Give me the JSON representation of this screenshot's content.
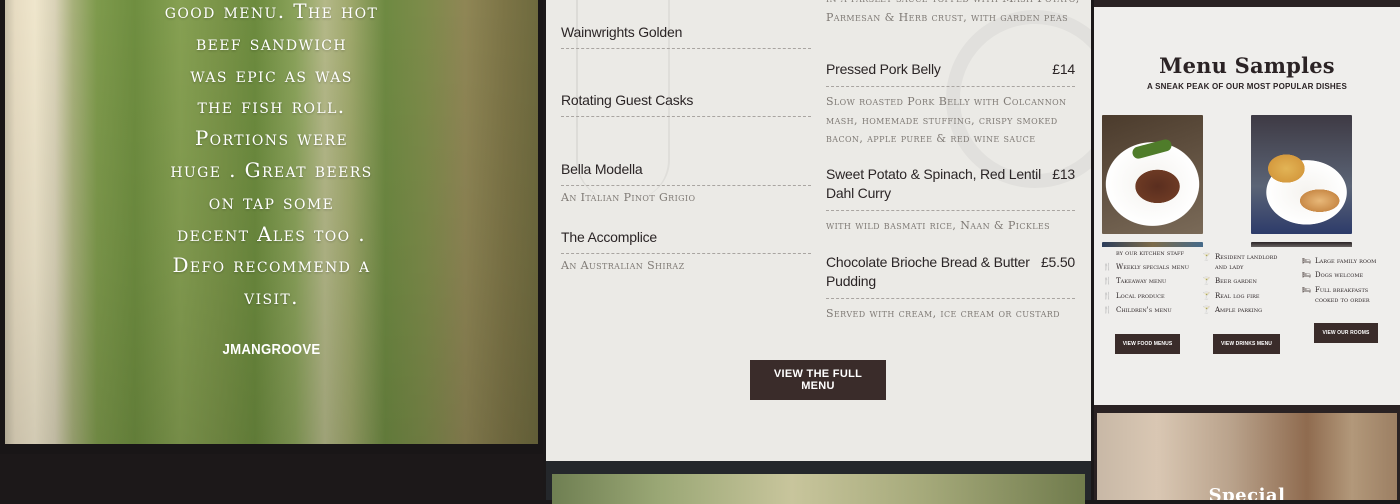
{
  "review": {
    "text": "good menu. The hot\nbeef sandwich\nwas epic as was\nthe fish roll.\nPortions were\nhuge . Great beers\non tap some\ndecent Ales too .\nDefo recommend a\nvisit.",
    "author": "JMANGROOVE"
  },
  "menu": {
    "top_description": "in a parsley sauce topped with Mash Potato, Parmesan & Herb crust, with garden peas",
    "drinks": [
      {
        "name": "Wainwrights Golden",
        "desc": ""
      },
      {
        "name": "Rotating Guest Casks",
        "desc": ""
      },
      {
        "name": "Bella Modella",
        "desc": "An Italian Pinot Grigio"
      },
      {
        "name": "The Accomplice",
        "desc": "An Australian Shiraz"
      }
    ],
    "dishes": [
      {
        "name": "Pressed Pork Belly",
        "price": "£14",
        "desc": "Slow roasted Pork Belly with Colcannon mash, homemade stuffing, crispy smoked bacon, apple puree & red wine sauce"
      },
      {
        "name": "Sweet Potato & Spinach, Red Lentil Dahl Curry",
        "price": "£13",
        "desc": "with wild basmati rice, Naan & Pickles"
      },
      {
        "name": "Chocolate Brioche Bread & Butter Pudding",
        "price": "£5.50",
        "desc": "Served with cream, ice cream or custard"
      }
    ],
    "full_menu_button": "VIEW THE FULL MENU"
  },
  "samples": {
    "title": "Menu Samples",
    "subtitle": "A SNEAK PEAK OF OUR MOST POPULAR DISHES"
  },
  "features": {
    "col1": [
      "by our kitchen staff",
      "Weekly specials menu",
      "Takeaway menu",
      "Local produce",
      "Children's menu"
    ],
    "col2": [
      "Resident landlord",
      "and lady",
      "Beer garden",
      "Real log fire",
      "Ample parking"
    ],
    "col3": [
      "Large family room",
      "Dogs welcome",
      "Full breakfasts",
      "cooked to order"
    ],
    "buttons": {
      "food": "VIEW FOOD MENUS",
      "drinks": "VIEW DRINKS MENU",
      "rooms": "VIEW OUR ROOMS"
    }
  },
  "special": {
    "title": "Special"
  }
}
